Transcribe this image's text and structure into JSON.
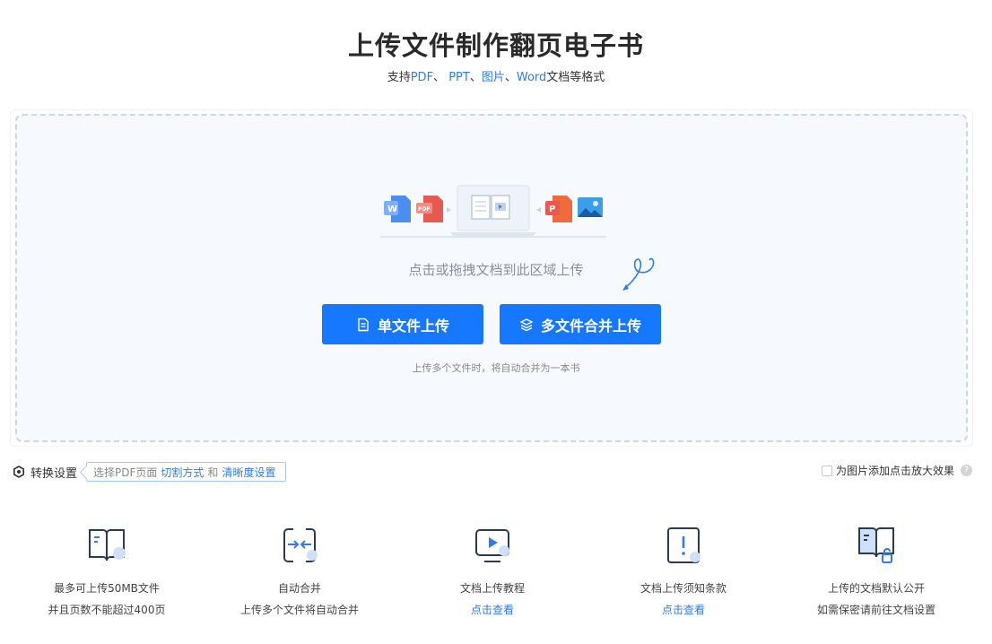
{
  "header": {
    "title": "上传文件制作翻页电子书",
    "subtitle_prefix": "支持",
    "fmt_pdf": "PDF",
    "sep1": "、 ",
    "fmt_ppt": "PPT",
    "sep2": "、",
    "fmt_img": "图片",
    "sep3": "、",
    "fmt_word": "Word",
    "subtitle_suffix": "文档等格式"
  },
  "upload": {
    "hint": "点击或拖拽文档到此区域上传",
    "single_label": "单文件上传",
    "multi_label": "多文件合并上传",
    "note": "上传多个文件时，将自动合并为一本书"
  },
  "settings": {
    "label": "转换设置",
    "tip_prefix": "选择PDF页面",
    "link_cut": "切割方式",
    "tip_and": "和",
    "link_clarity": "清晰度设置",
    "zoom_option": "为图片添加点击放大效果",
    "help": "?"
  },
  "features": [
    {
      "icon": "book-icon",
      "line1": "最多可上传50MB文件",
      "line2": "并且页数不能超过400页"
    },
    {
      "icon": "merge-icon",
      "line1": "自动合并",
      "line2": "上传多个文件将自动合并"
    },
    {
      "icon": "video-tutorial-icon",
      "line1": "文档上传教程",
      "line2": "点击查看"
    },
    {
      "icon": "notice-icon",
      "line1": "文档上传须知条款",
      "line2": "点击查看"
    },
    {
      "icon": "book-lock-icon",
      "line1": "上传的文档默认公开",
      "line2": "如需保密请前往文档设置"
    }
  ],
  "colors": {
    "primary": "#1677ff",
    "link": "#2f7ce6",
    "dropzone_bg": "#f6f9fd"
  }
}
